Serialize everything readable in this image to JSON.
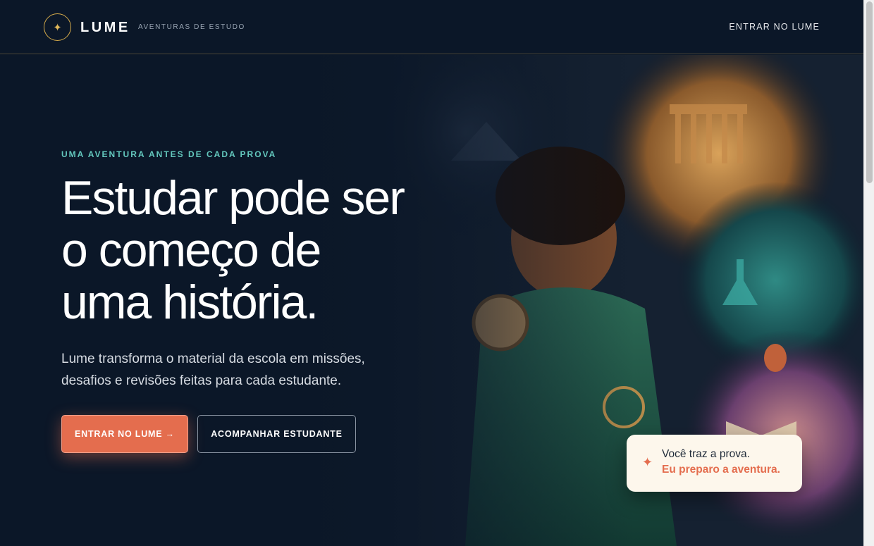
{
  "header": {
    "logo_icon": "sparkle-icon",
    "brand": "LUME",
    "tagline": "AVENTURAS DE ESTUDO",
    "nav_login": "ENTRAR NO LUME"
  },
  "hero": {
    "eyebrow": "UMA AVENTURA ANTES DE CADA PROVA",
    "headline_line1": "Estudar pode ser",
    "headline_line2": "o começo de",
    "headline_line3": "uma história.",
    "subtext_line1": "Lume transforma o material da escola em missões,",
    "subtext_line2": "desafios e revisões feitas para cada estudante.",
    "primary_button": "ENTRAR NO LUME →",
    "secondary_button": "ACOMPANHAR ESTUDANTE"
  },
  "promo_card": {
    "icon": "sparkle-icon",
    "line1": "Você traz a prova.",
    "line2": "Eu preparo a aventura."
  },
  "colors": {
    "background": "#0b1728",
    "accent": "#e46d4e",
    "teal": "#63c7bd",
    "gold": "#d3a94a"
  }
}
